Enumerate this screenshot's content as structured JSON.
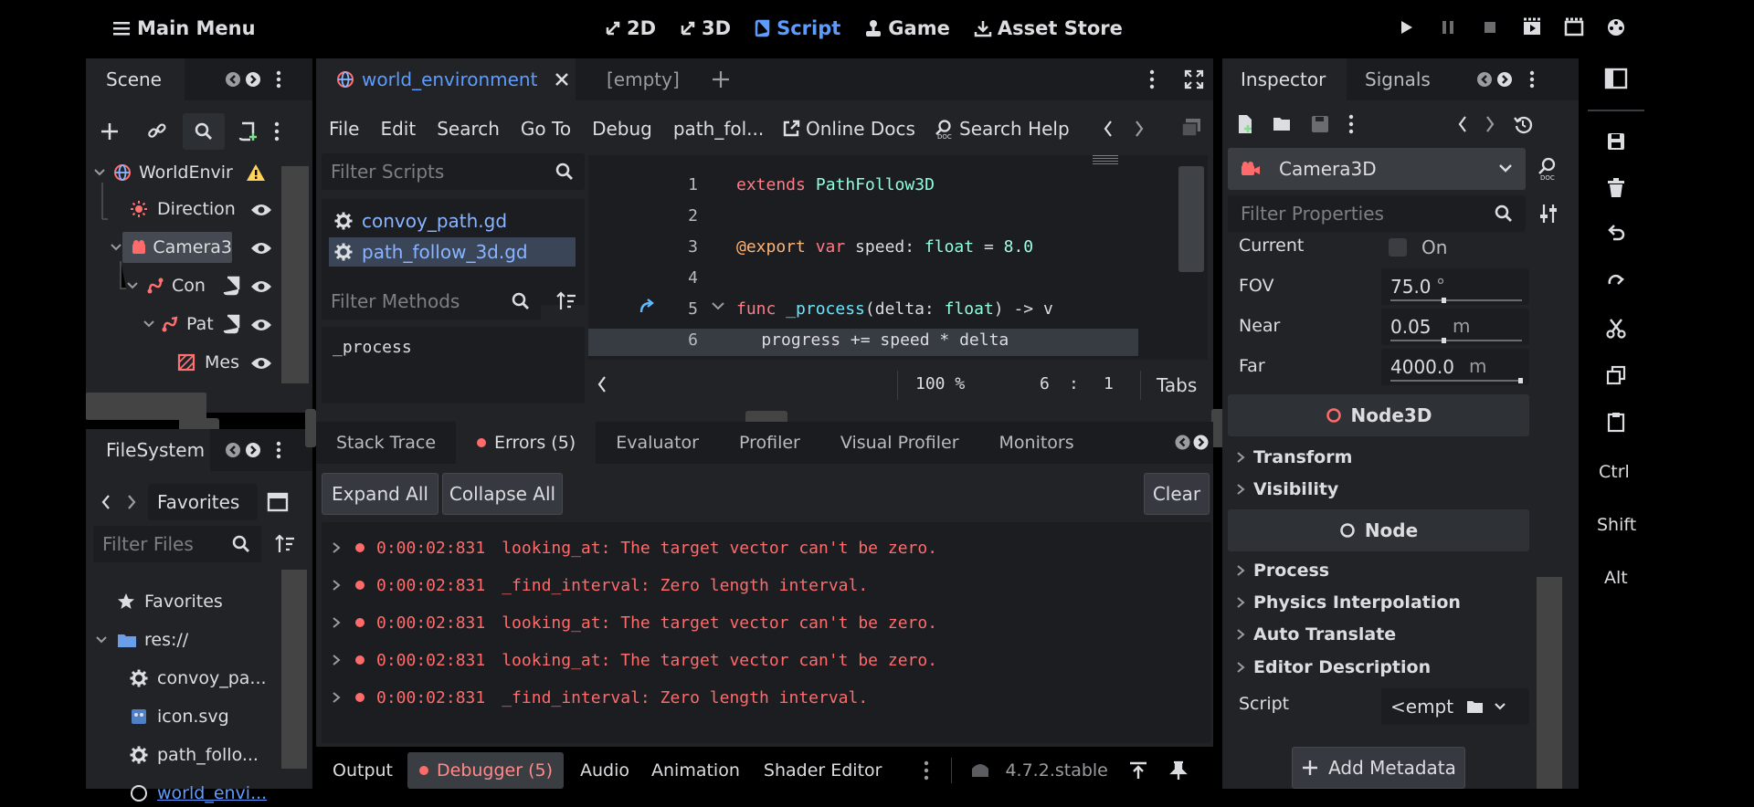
{
  "topbar": {
    "main_menu": "Main Menu",
    "modes": [
      "2D",
      "3D",
      "Script",
      "Game",
      "Asset Store"
    ],
    "active_mode": "Script"
  },
  "scene_dock": {
    "tab": "Scene",
    "tree": [
      {
        "label": "WorldEnvir",
        "icon": "globe-icon",
        "warning": true
      },
      {
        "label": "Direction",
        "icon": "sun-light-icon"
      },
      {
        "label": "Camera3",
        "icon": "camera-icon"
      },
      {
        "label": "Con",
        "icon": "path-icon"
      },
      {
        "label": "Pat",
        "icon": "path-follow-icon"
      },
      {
        "label": "Mes",
        "icon": "mesh-icon"
      }
    ]
  },
  "filesystem": {
    "tab": "FileSystem",
    "favorites_label": "Favorites",
    "filter_placeholder": "Filter Files",
    "items": [
      {
        "label": "Favorites",
        "icon": "star-icon"
      },
      {
        "label": "res://",
        "icon": "folder-icon"
      },
      {
        "label": "convoy_pa...",
        "icon": "gear-icon"
      },
      {
        "label": "icon.svg",
        "icon": "image-icon"
      },
      {
        "label": "path_follo...",
        "icon": "gear-icon"
      },
      {
        "label": "world_envi...",
        "icon": "globe-icon"
      }
    ]
  },
  "script_editor": {
    "tabs": [
      {
        "label": "world_environment"
      },
      {
        "label": "[empty]"
      }
    ],
    "menu": [
      "File",
      "Edit",
      "Search",
      "Go To",
      "Debug",
      "path_fol..."
    ],
    "online_docs": "Online Docs",
    "search_help": "Search Help",
    "filter_scripts": "Filter Scripts",
    "scripts": [
      "convoy_path.gd",
      "path_follow_3d.gd"
    ],
    "filter_methods": "Filter Methods",
    "methods": [
      "_process"
    ],
    "code": [
      {
        "n": "1",
        "t": "extends PathFollow3D"
      },
      {
        "n": "2",
        "t": ""
      },
      {
        "n": "3",
        "t": "@export var speed: float = 8.0"
      },
      {
        "n": "4",
        "t": ""
      },
      {
        "n": "5",
        "t": "func _process(delta: float) -> v"
      },
      {
        "n": "6",
        "t": "    progress += speed * delta"
      }
    ],
    "zoom": "100 %",
    "line": "6",
    "col": "1",
    "indent": "Tabs"
  },
  "debugger": {
    "tabs": [
      "Stack Trace",
      "Errors (5)",
      "Evaluator",
      "Profiler",
      "Visual Profiler",
      "Monitors"
    ],
    "expand_all": "Expand All",
    "collapse_all": "Collapse All",
    "clear": "Clear",
    "errors": [
      {
        "time": "0:00:02:831",
        "msg": "looking_at: The target vector can't be zero."
      },
      {
        "time": "0:00:02:831",
        "msg": "_find_interval: Zero length interval."
      },
      {
        "time": "0:00:02:831",
        "msg": "looking_at: The target vector can't be zero."
      },
      {
        "time": "0:00:02:831",
        "msg": "looking_at: The target vector can't be zero."
      },
      {
        "time": "0:00:02:831",
        "msg": "_find_interval: Zero length interval."
      }
    ]
  },
  "bottom_bar": {
    "tabs": [
      "Output",
      "Debugger (5)",
      "Audio",
      "Animation",
      "Shader Editor"
    ],
    "version": "4.7.2.stable"
  },
  "inspector": {
    "tabs": [
      "Inspector",
      "Signals"
    ],
    "node": "Camera3D",
    "filter_placeholder": "Filter Properties",
    "props": [
      {
        "label": "Current",
        "value": "On"
      },
      {
        "label": "FOV",
        "value": "75.0",
        "unit": "°"
      },
      {
        "label": "Near",
        "value": "0.05",
        "unit": "m"
      },
      {
        "label": "Far",
        "value": "4000.0",
        "unit": "m"
      }
    ],
    "section_node3d": "Node3D",
    "node3d_groups": [
      "Transform",
      "Visibility"
    ],
    "section_node": "Node",
    "node_groups": [
      "Process",
      "Physics Interpolation",
      "Auto Translate",
      "Editor Description"
    ],
    "script_label": "Script",
    "script_value": "<empt",
    "add_metadata": "Add Metadata"
  },
  "right_strip": {
    "keys": [
      "Ctrl",
      "Shift",
      "Alt"
    ]
  },
  "colors": {
    "accent": "#5d9cff",
    "error": "#ff6b6b",
    "panel": "#212327",
    "bg": "#000000"
  }
}
